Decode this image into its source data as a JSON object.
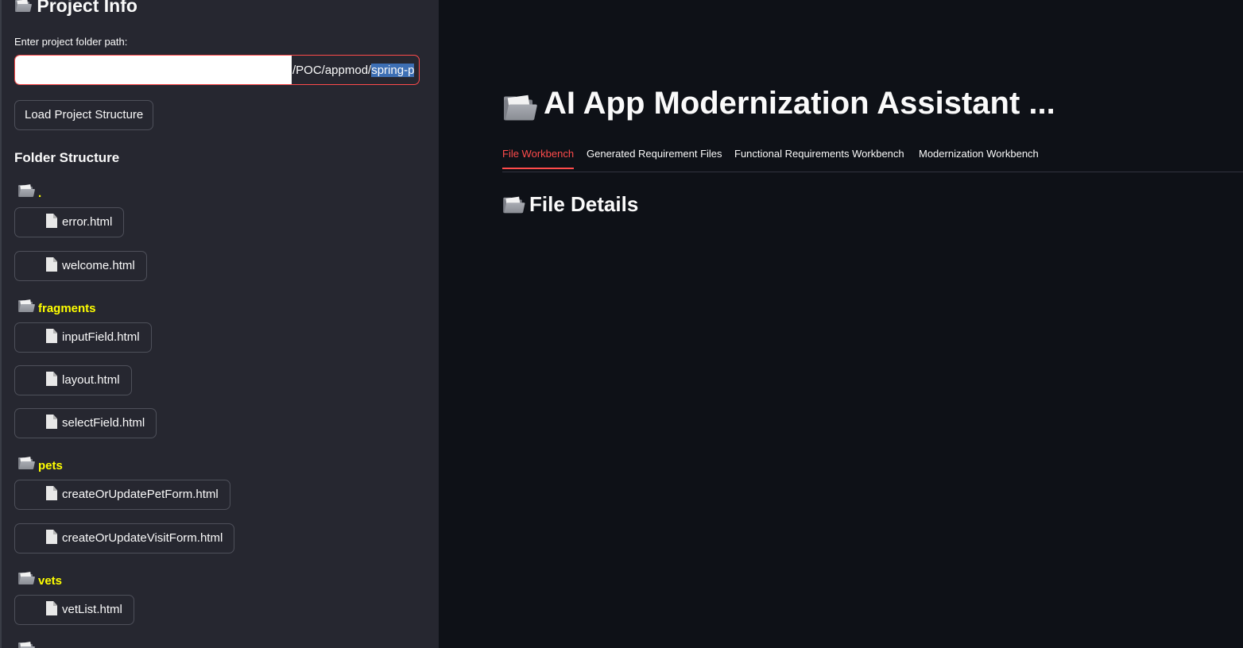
{
  "sidebar": {
    "title": "Project Info",
    "path_label": "Enter project folder path:",
    "path_value_visible": "/POC/appmod/",
    "path_value_selected": "spring-p",
    "load_button": "Load Project Structure",
    "folder_heading": "Folder Structure",
    "folders": [
      {
        "name": ".",
        "files": [
          "error.html",
          "welcome.html"
        ]
      },
      {
        "name": "fragments",
        "files": [
          "inputField.html",
          "layout.html",
          "selectField.html"
        ]
      },
      {
        "name": "pets",
        "files": [
          "createOrUpdatePetForm.html",
          "createOrUpdateVisitForm.html"
        ]
      },
      {
        "name": "vets",
        "files": [
          "vetList.html"
        ]
      }
    ]
  },
  "main": {
    "title": "AI App Modernization Assistant ...",
    "tabs": [
      {
        "label": "File Workbench",
        "active": true
      },
      {
        "label": "Generated Requirement Files",
        "active": false
      },
      {
        "label": "Functional Requirements Workbench",
        "active": false
      },
      {
        "label": "Modernization Workbench",
        "active": false
      }
    ],
    "section_title": "File Details"
  },
  "colors": {
    "accent": "#ff4b4b",
    "folder_label": "#ffff00",
    "sidebar_bg": "#262730",
    "main_bg": "#0e1117"
  }
}
